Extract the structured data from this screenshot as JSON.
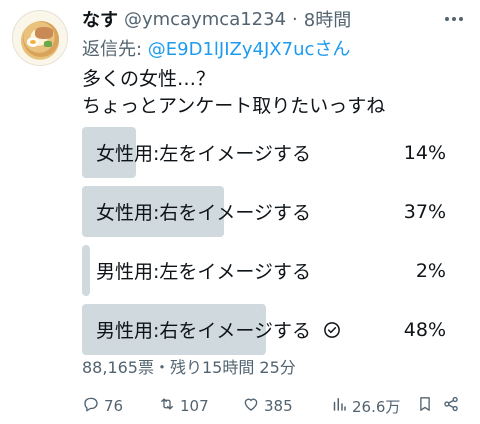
{
  "author": {
    "name": "なす",
    "handle": "@ymcaymca1234",
    "separator": "·",
    "time": "8時間"
  },
  "reply": {
    "prefix": "返信先: ",
    "to": "@E9D1lJIZy4JX7ucさん"
  },
  "text": {
    "line1": "多くの女性…？",
    "line2": "ちょっとアンケート取りたいっすね"
  },
  "poll": {
    "options": [
      {
        "label": "女性用:左をイメージする",
        "percent_text": "14%",
        "percent": 14,
        "selected": false
      },
      {
        "label": "女性用:右をイメージする",
        "percent_text": "37%",
        "percent": 37,
        "selected": false
      },
      {
        "label": "男性用:左をイメージする",
        "percent_text": "2%",
        "percent": 2,
        "selected": false
      },
      {
        "label": "男性用:右をイメージする",
        "percent_text": "48%",
        "percent": 48,
        "selected": true
      }
    ],
    "meta": "88,165票・残り15時間 25分"
  },
  "actions": {
    "reply_count": "76",
    "retweet_count": "107",
    "like_count": "385",
    "views_count": "26.6万"
  },
  "colors": {
    "bar": "#cfd9de",
    "link": "#1d9bf0",
    "secondary_text": "#536471"
  },
  "icons": [
    "reply-icon",
    "retweet-icon",
    "like-icon",
    "views-icon",
    "bookmark-icon",
    "share-icon",
    "more-icon",
    "check-circle-icon"
  ]
}
